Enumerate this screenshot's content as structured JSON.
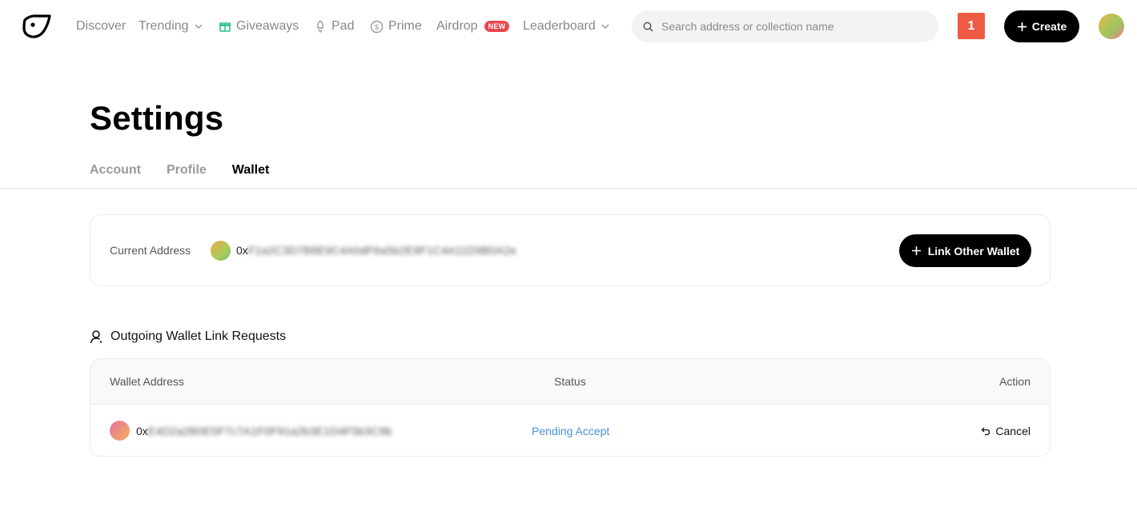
{
  "nav": {
    "items": [
      {
        "label": "Discover"
      },
      {
        "label": "Trending"
      },
      {
        "label": "Giveaways"
      },
      {
        "label": "Pad"
      },
      {
        "label": "Prime"
      },
      {
        "label": "Airdrop",
        "badge": "NEW"
      },
      {
        "label": "Leaderboard"
      }
    ],
    "search_placeholder": "Search address or collection name",
    "notification_count": "1",
    "create_label": "Create",
    "colors": {
      "accent_green": "#2bbf8f",
      "notification": "#ee5b43",
      "new_badge": "#e8474f"
    }
  },
  "page": {
    "title": "Settings",
    "tabs": [
      {
        "label": "Account",
        "active": false
      },
      {
        "label": "Profile",
        "active": false
      },
      {
        "label": "Wallet",
        "active": true
      }
    ]
  },
  "current_address": {
    "label": "Current Address",
    "prefix": "0x",
    "masked": "F1a2C3D7B8E9C4A0dF6a5b2E9F1C4A11D9B0A2e",
    "button_label": "Link Other Wallet"
  },
  "outgoing": {
    "heading": "Outgoing Wallet Link Requests",
    "columns": [
      "Wallet Address",
      "Status",
      "Action"
    ],
    "rows": [
      {
        "prefix": "0x",
        "masked": "E4D2a2B0E5F7c7A1F0F91a2b3E1D4F5b3C9b",
        "status": "Pending Accept",
        "action": "Cancel"
      }
    ],
    "status_color": "#4a90d9"
  }
}
